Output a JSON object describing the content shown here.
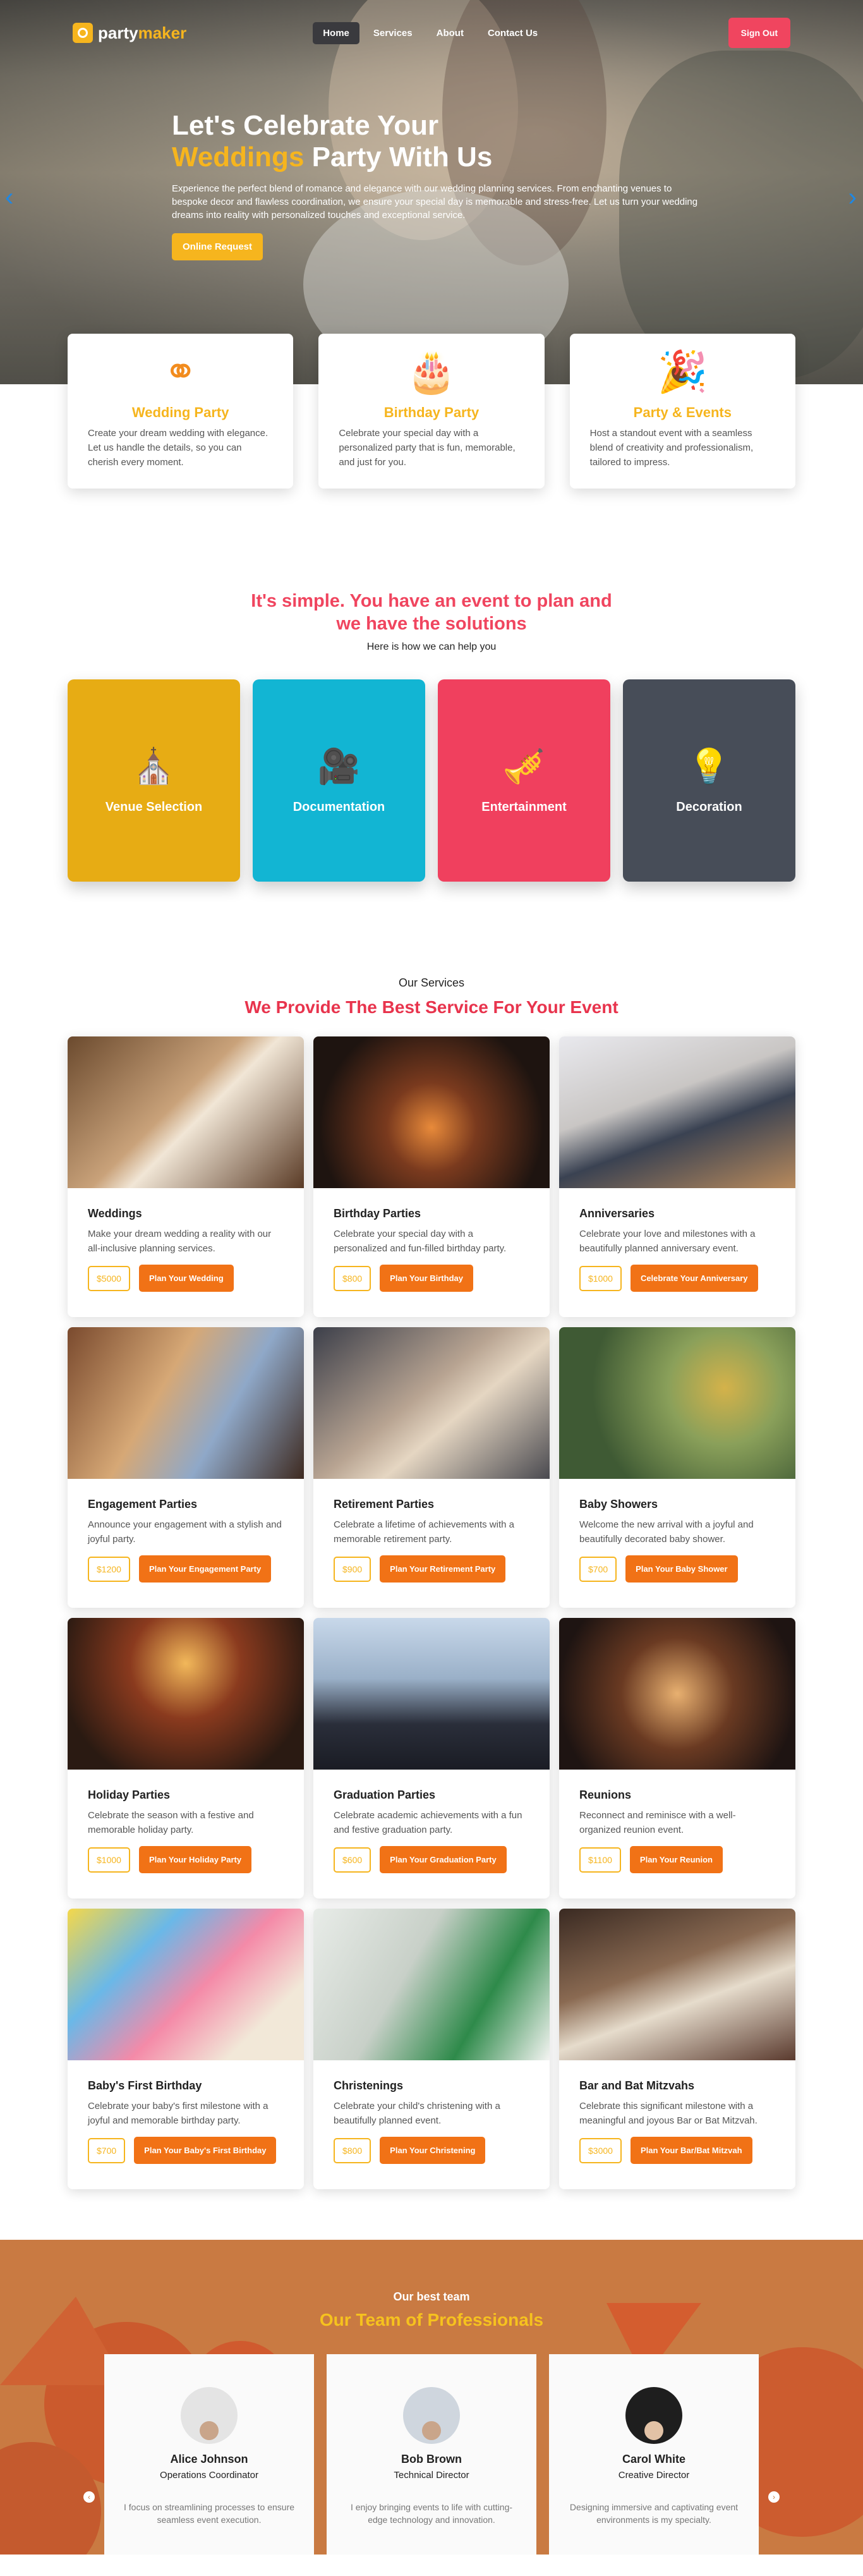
{
  "brand": {
    "part1": "party",
    "part2": "maker"
  },
  "nav": {
    "items": [
      "Home",
      "Services",
      "About",
      "Contact Us"
    ],
    "signout": "Sign Out"
  },
  "hero": {
    "title_line1": "Let's Celebrate Your",
    "title_highlight": "Weddings",
    "title_rest": " Party With Us",
    "description": "Experience the perfect blend of romance and elegance with our wedding planning services. From enchanting venues to bespoke decor and flawless coordination, we ensure your special day is memorable and stress-free. Let us turn your wedding dreams into reality with personalized touches and exceptional service.",
    "cta": "Online Request"
  },
  "features": [
    {
      "title": "Wedding Party",
      "text": "Create your dream wedding with elegance. Let us handle the details, so you can cherish every moment.",
      "icon": "rings-icon"
    },
    {
      "title": "Birthday Party",
      "text": "Celebrate your special day with a personalized party that is fun, memorable, and just for you.",
      "icon": "cake-icon"
    },
    {
      "title": "Party & Events",
      "text": "Host a standout event with a seamless blend of creativity and professionalism, tailored to impress.",
      "icon": "party-popper-icon"
    }
  ],
  "simple": {
    "title_line1": "It's simple. You have an event to plan and",
    "title_line2": "we have the solutions",
    "subtitle": "Here is how we can help you"
  },
  "tiles": [
    {
      "label": "Venue Selection",
      "color": "#e7ac14",
      "icon": "venue-icon"
    },
    {
      "label": "Documentation",
      "color": "#12b5d3",
      "icon": "camera-icon"
    },
    {
      "label": "Entertainment",
      "color": "#f0405e",
      "icon": "trumpet-icon"
    },
    {
      "label": "Decoration",
      "color": "#474d58",
      "icon": "lightbulb-icon"
    }
  ],
  "services": {
    "small": "Our Services",
    "title": "We Provide The Best Service For Your Event",
    "items": [
      {
        "title": "Weddings",
        "text": "Make your dream wedding a reality with our all-inclusive planning services.",
        "price": "$5000",
        "button": "Plan Your Wedding"
      },
      {
        "title": "Birthday Parties",
        "text": "Celebrate your special day with a personalized and fun-filled birthday party.",
        "price": "$800",
        "button": "Plan Your Birthday"
      },
      {
        "title": "Anniversaries",
        "text": "Celebrate your love and milestones with a beautifully planned anniversary event.",
        "price": "$1000",
        "button": "Celebrate Your Anniversary"
      },
      {
        "title": "Engagement Parties",
        "text": "Announce your engagement with a stylish and joyful party.",
        "price": "$1200",
        "button": "Plan Your Engagement Party"
      },
      {
        "title": "Retirement Parties",
        "text": "Celebrate a lifetime of achievements with a memorable retirement party.",
        "price": "$900",
        "button": "Plan Your Retirement Party"
      },
      {
        "title": "Baby Showers",
        "text": "Welcome the new arrival with a joyful and beautifully decorated baby shower.",
        "price": "$700",
        "button": "Plan Your Baby Shower"
      },
      {
        "title": "Holiday Parties",
        "text": "Celebrate the season with a festive and memorable holiday party.",
        "price": "$1000",
        "button": "Plan Your Holiday Party"
      },
      {
        "title": "Graduation Parties",
        "text": "Celebrate academic achievements with a fun and festive graduation party.",
        "price": "$600",
        "button": "Plan Your Graduation Party"
      },
      {
        "title": "Reunions",
        "text": "Reconnect and reminisce with a well-organized reunion event.",
        "price": "$1100",
        "button": "Plan Your Reunion"
      },
      {
        "title": "Baby's First Birthday",
        "text": "Celebrate your baby's first milestone with a joyful and memorable birthday party.",
        "price": "$700",
        "button": "Plan Your Baby's First Birthday"
      },
      {
        "title": "Christenings",
        "text": "Celebrate your child's christening with a beautifully planned event.",
        "price": "$800",
        "button": "Plan Your Christening"
      },
      {
        "title": "Bar and Bat Mitzvahs",
        "text": "Celebrate this significant milestone with a meaningful and joyous Bar or Bat Mitzvah.",
        "price": "$3000",
        "button": "Plan Your Bar/Bat Mitzvah"
      }
    ]
  },
  "team": {
    "small": "Our best team",
    "title": "Our Team of Professionals",
    "members": [
      {
        "name": "Alice Johnson",
        "role": "Operations Coordinator",
        "bio": "I focus on streamlining processes to ensure seamless event execution."
      },
      {
        "name": "Bob Brown",
        "role": "Technical Director",
        "bio": "I enjoy bringing events to life with cutting-edge technology and innovation."
      },
      {
        "name": "Carol White",
        "role": "Creative Director",
        "bio": "Designing immersive and captivating event environments is my specialty."
      }
    ]
  },
  "colors": {
    "accent": "#f6b51e",
    "red": "#f0455f",
    "orange": "#f17216"
  }
}
